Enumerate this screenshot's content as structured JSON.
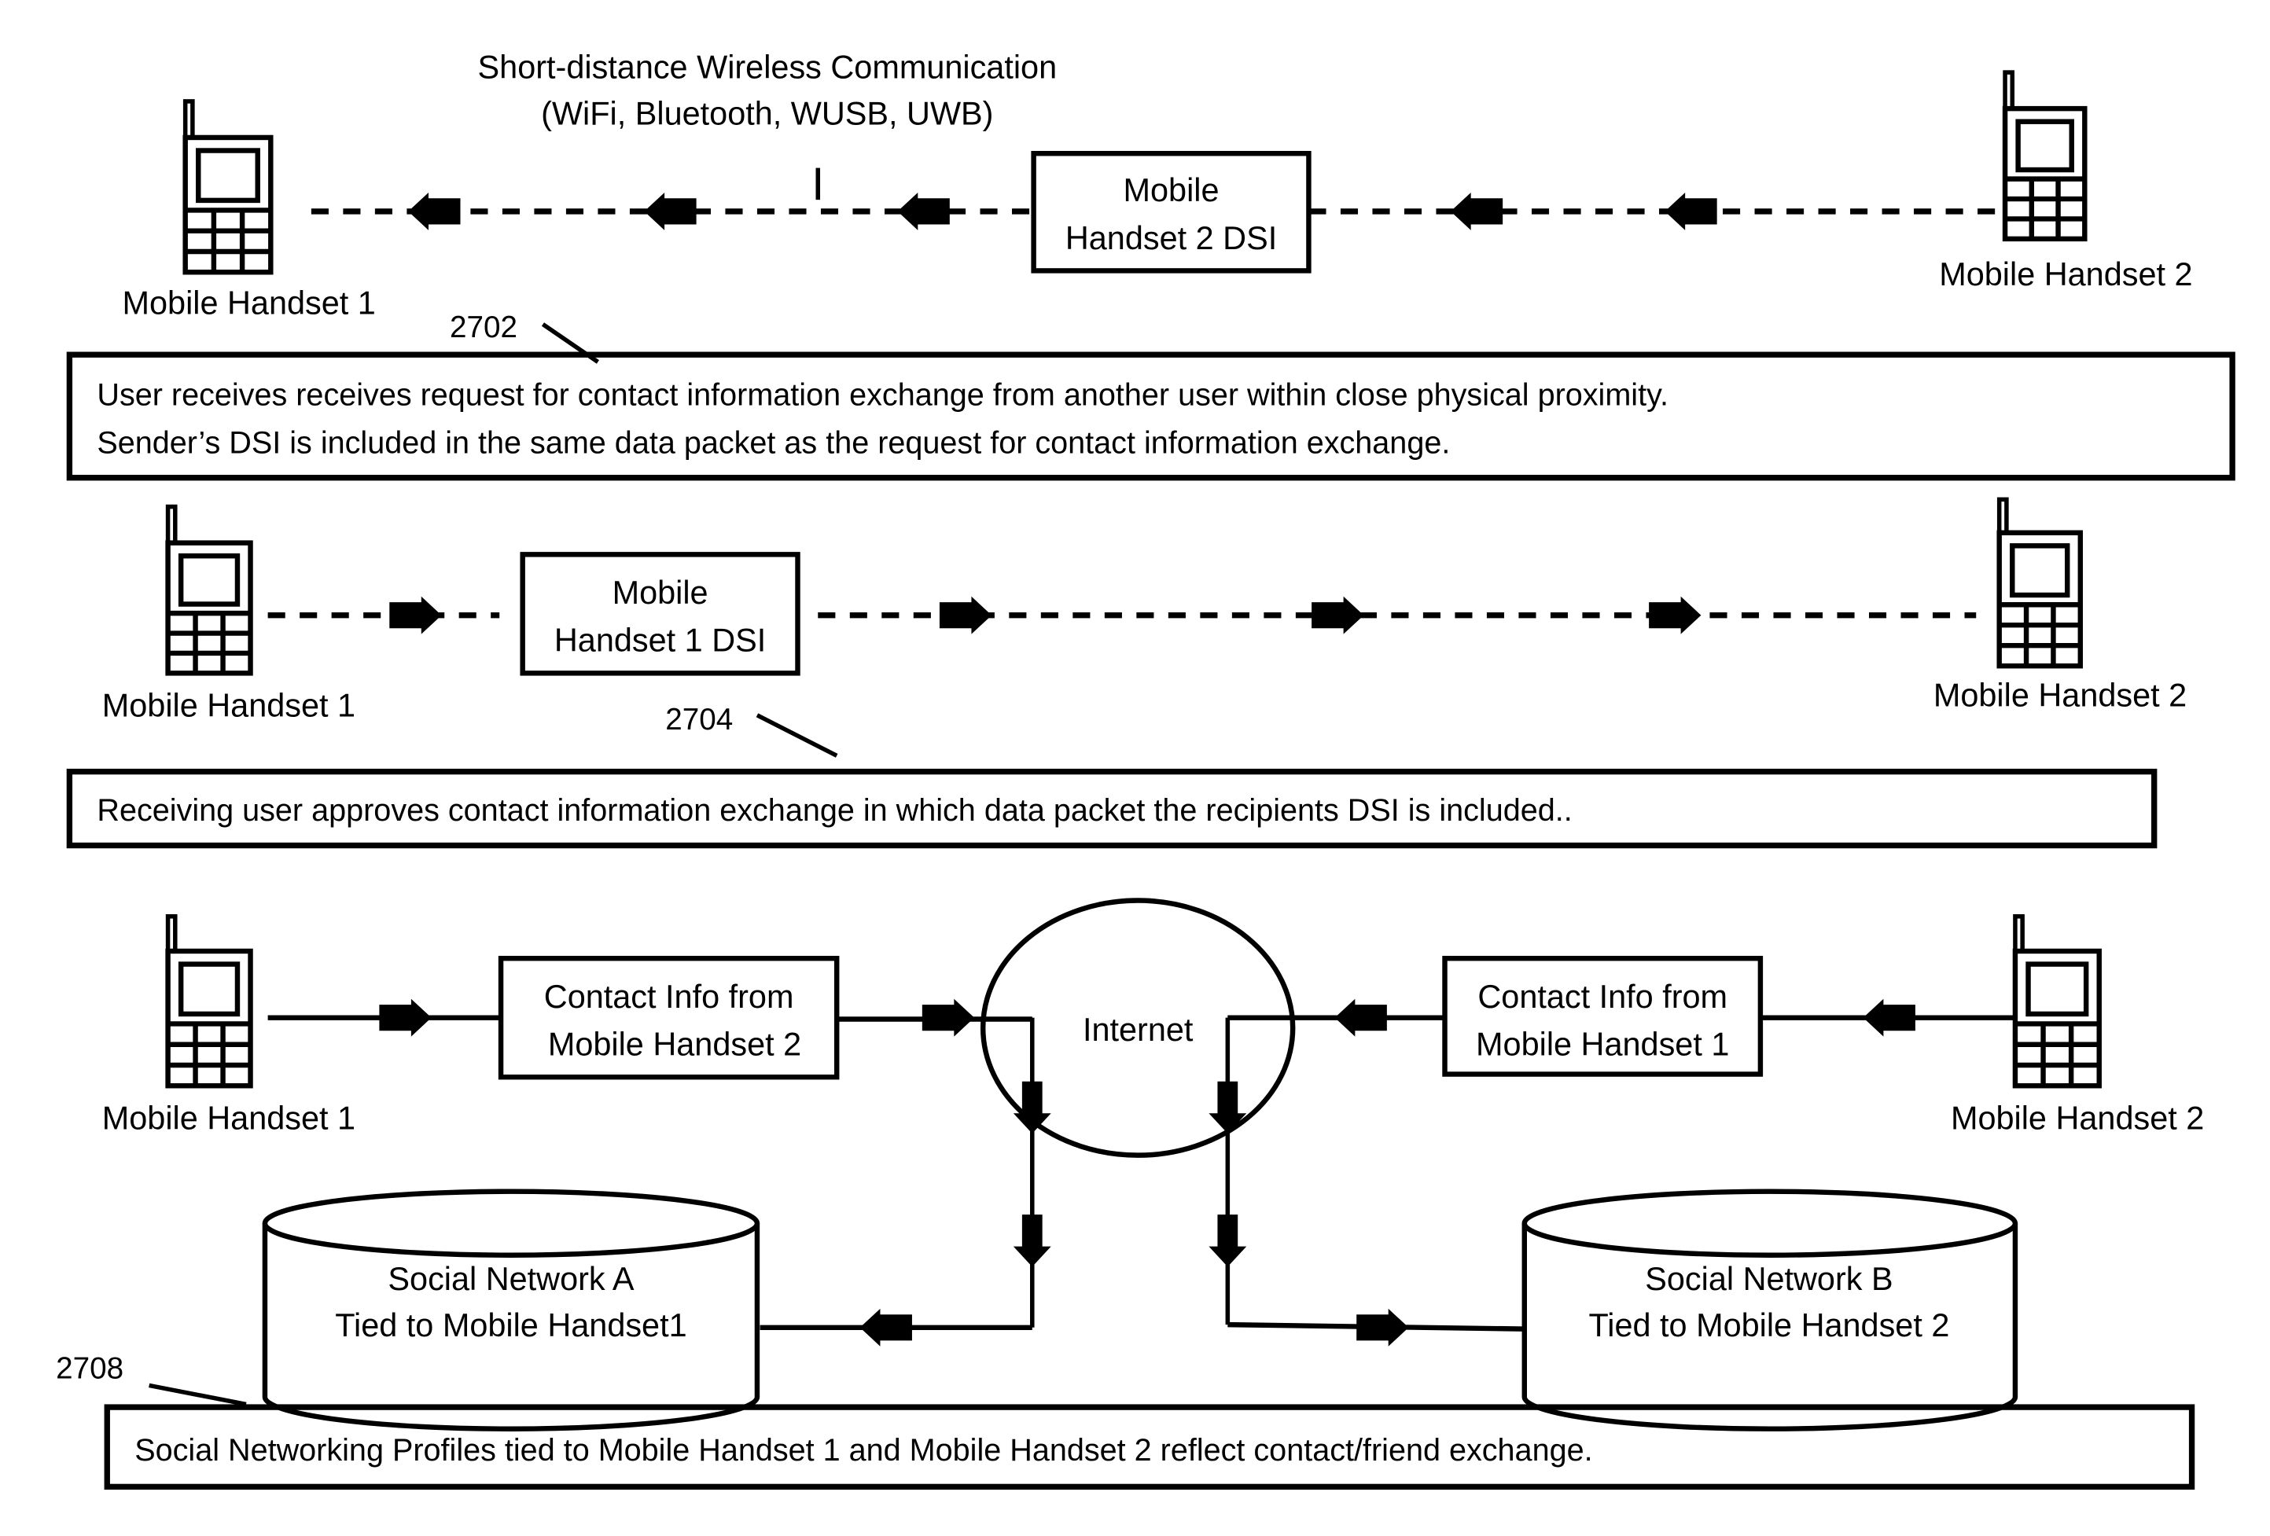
{
  "figure": {
    "wireless_title": [
      "Short-distance Wireless Communication",
      "(WiFi, Bluetooth, WUSB, UWB)"
    ],
    "cursor_mark": "I",
    "colors": {
      "ink": "#000000",
      "paper": "#ffffff"
    }
  },
  "step_2702": {
    "ref": "2702",
    "handset_left": "Mobile Handset 1",
    "handset_right": "Mobile Handset 2",
    "packet_box": [
      "Mobile",
      "Handset 2 DSI"
    ],
    "direction": "right-to-left",
    "link_type": "dashed-wireless",
    "description": [
      "User receives receives request for contact information exchange from another user within close physical proximity.",
      "Sender’s DSI is included in the same data packet as the request for contact information exchange."
    ]
  },
  "step_2704": {
    "ref": "2704",
    "handset_left": "Mobile Handset 1",
    "handset_right": "Mobile Handset 2",
    "packet_box": [
      "Mobile",
      "Handset 1 DSI"
    ],
    "direction": "left-to-right",
    "link_type": "dashed-wireless",
    "description": "Receiving user approves contact information exchange in which data packet the recipients DSI is included.."
  },
  "step_2708": {
    "ref": "2708",
    "handset_left": "Mobile Handset 1",
    "handset_right": "Mobile Handset 2",
    "contact_box_left": [
      "Contact Info from",
      "Mobile Handset 2"
    ],
    "contact_box_right": [
      "Contact Info from",
      "Mobile Handset 1"
    ],
    "cloud": "Internet",
    "database_left": [
      "Social Network A",
      "Tied to Mobile Handset1"
    ],
    "database_right": [
      "Social Network B",
      "Tied to Mobile Handset 2"
    ],
    "link_type": "solid",
    "description": "Social Networking Profiles tied to Mobile Handset 1 and Mobile Handset 2 reflect contact/friend exchange."
  }
}
